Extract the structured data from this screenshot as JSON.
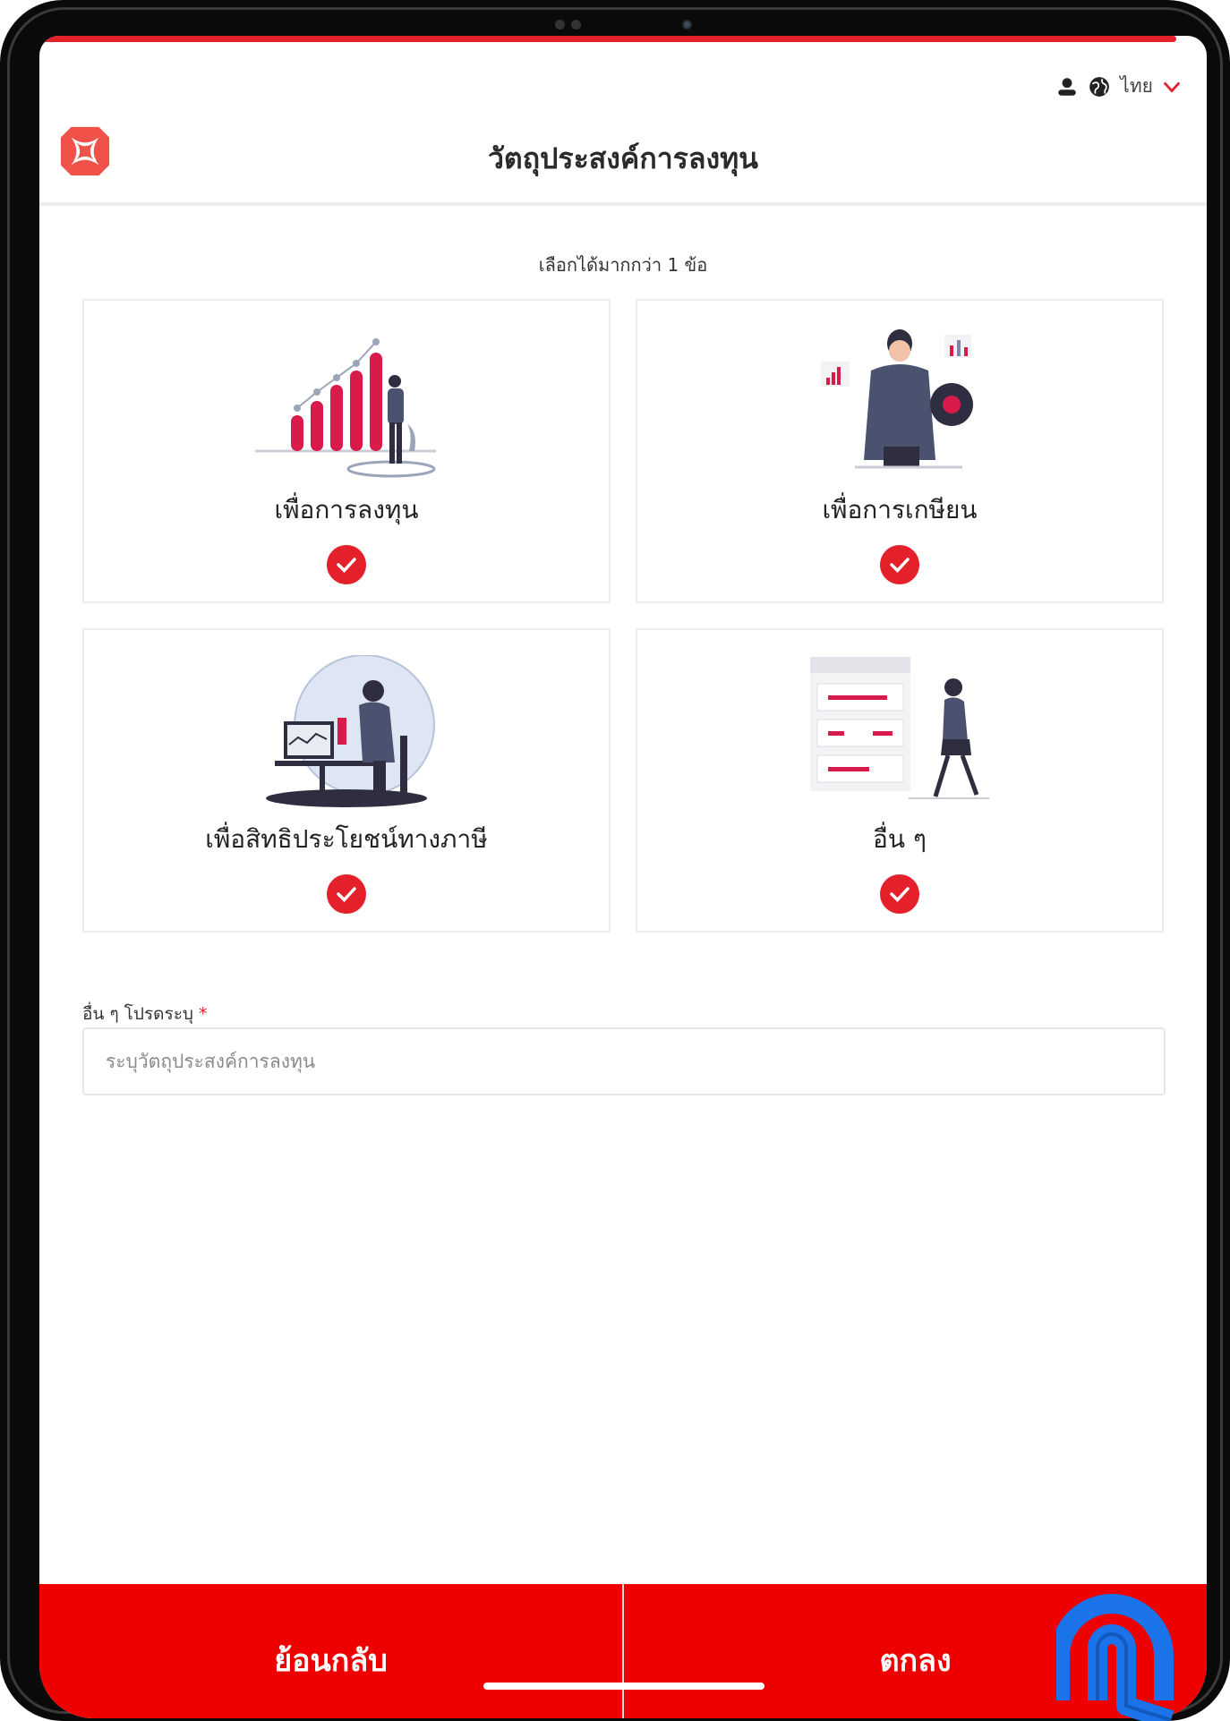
{
  "header": {
    "language_label": "ไทย",
    "title": "วัตถุประสงค์การลงทุน"
  },
  "hint": "เลือกได้มากกว่า 1 ข้อ",
  "options": [
    {
      "label": "เพื่อการลงทุน",
      "selected": true,
      "illustration": "growth-chart-illustration"
    },
    {
      "label": "เพื่อการเกษียน",
      "selected": true,
      "illustration": "man-with-charts-illustration"
    },
    {
      "label": "เพื่อสิทธิประโยชน์ทางภาษี",
      "selected": true,
      "illustration": "person-at-desk-illustration"
    },
    {
      "label": "อื่น ๆ",
      "selected": true,
      "illustration": "woman-with-list-illustration"
    }
  ],
  "other_field": {
    "label": "อื่น ๆ โปรดระบุ",
    "required_mark": "*",
    "value": "",
    "placeholder": "ระบุวัตถุประสงค์การลงทุน"
  },
  "footer": {
    "back_label": "ย้อนกลับ",
    "confirm_label": "ตกลง"
  },
  "colors": {
    "brand_red": "#ee0000",
    "check_red": "#e4202a",
    "cursor_blue": "#1a73e8"
  }
}
